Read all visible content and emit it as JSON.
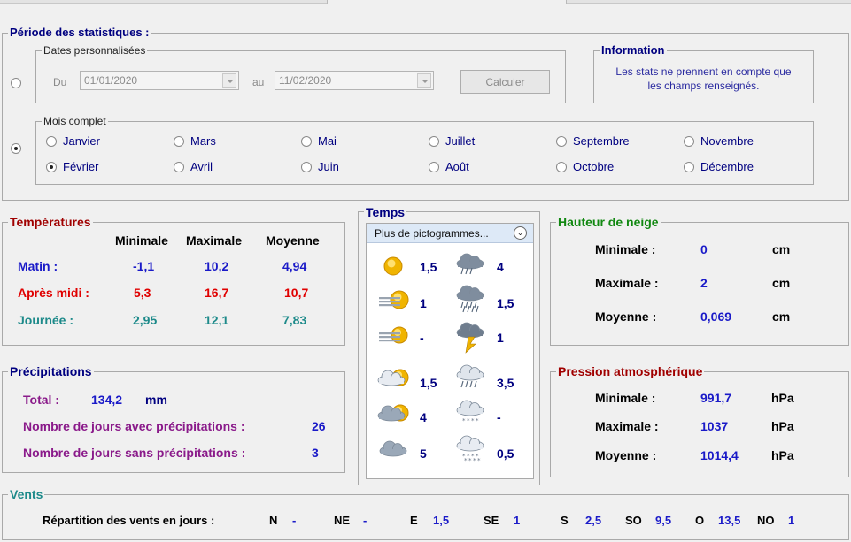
{
  "periode": {
    "title": "Période des statistiques :",
    "dates_label": "Dates personnalisées",
    "du_label": "Du",
    "du_value": "01/01/2020",
    "au_label": "au",
    "au_value": "11/02/2020",
    "calc_label": "Calculer",
    "mois_label": "Mois complet",
    "mois": [
      "Janvier",
      "Mars",
      "Mai",
      "Juillet",
      "Septembre",
      "Novembre",
      "Février",
      "Avril",
      "Juin",
      "Août",
      "Octobre",
      "Décembre"
    ],
    "selected_month": "Février"
  },
  "information": {
    "title": "Information",
    "line1": "Les stats ne prennent en compte que",
    "line2": "les champs renseignés."
  },
  "temperatures": {
    "title": "Températures",
    "col_min": "Minimale",
    "col_max": "Maximale",
    "col_moy": "Moyenne",
    "rows": [
      {
        "label": "Matin :",
        "min": "-1,1",
        "max": "10,2",
        "moy": "4,94"
      },
      {
        "label": "Après midi :",
        "min": "5,3",
        "max": "16,7",
        "moy": "10,7"
      },
      {
        "label": "Journée :",
        "min": "2,95",
        "max": "12,1",
        "moy": "7,83"
      }
    ]
  },
  "temps": {
    "title": "Temps",
    "dropdown": "Plus de pictogrammes...",
    "left_values": [
      "1,5",
      "1",
      "-",
      "1,5",
      "4",
      "5"
    ],
    "right_values": [
      "4",
      "1,5",
      "1",
      "3,5",
      "-",
      "0,5"
    ],
    "icons_left": [
      "sun-icon",
      "sun-fog-icon",
      "fog-sun-icon",
      "cloud-sun-icon",
      "dark-cloud-sun-icon",
      "cloud-icon"
    ],
    "icons_right": [
      "rain-cloud-icon",
      "heavy-rain-icon",
      "storm-icon",
      "shower-icon",
      "snow-rain-icon",
      "snow-icon"
    ]
  },
  "neige": {
    "title": "Hauteur de neige",
    "rows": [
      {
        "label": "Minimale :",
        "value": "0",
        "unit": "cm"
      },
      {
        "label": "Maximale :",
        "value": "2",
        "unit": "cm"
      },
      {
        "label": "Moyenne :",
        "value": "0,069",
        "unit": "cm"
      }
    ]
  },
  "precipitations": {
    "title": "Précipitations",
    "total_label": "Total :",
    "total_value": "134,2",
    "total_unit": "mm",
    "avec_label": "Nombre de jours avec précipitations :",
    "avec_value": "26",
    "sans_label": "Nombre de jours sans précipitations :",
    "sans_value": "3"
  },
  "pression": {
    "title": "Pression atmosphérique",
    "rows": [
      {
        "label": "Minimale :",
        "value": "991,7",
        "unit": "hPa"
      },
      {
        "label": "Maximale :",
        "value": "1037",
        "unit": "hPa"
      },
      {
        "label": "Moyenne :",
        "value": "1014,4",
        "unit": "hPa"
      }
    ]
  },
  "vents": {
    "title": "Vents",
    "label": "Répartition des vents en jours :",
    "dirs": [
      {
        "dir": "N",
        "val": "-"
      },
      {
        "dir": "NE",
        "val": "-"
      },
      {
        "dir": "E",
        "val": "1,5"
      },
      {
        "dir": "SE",
        "val": "1"
      },
      {
        "dir": "S",
        "val": "2,5"
      },
      {
        "dir": "SO",
        "val": "9,5"
      },
      {
        "dir": "O",
        "val": "13,5"
      },
      {
        "dir": "NO",
        "val": "1"
      }
    ]
  },
  "colors": {
    "background": "#f0f0f0",
    "value_blue": "#1a1ac8",
    "navy": "#000080",
    "red": "#e00000",
    "teal": "#1d8a8a",
    "purple": "#8a1a8a",
    "dark_red": "#a00000",
    "green": "#118811"
  }
}
